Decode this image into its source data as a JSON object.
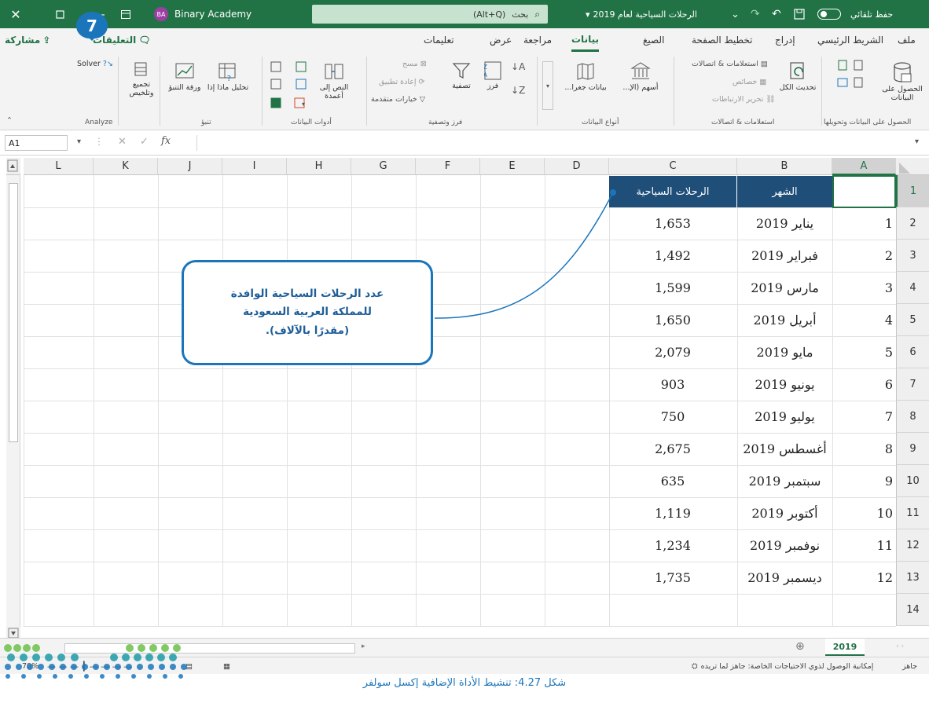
{
  "titlebar": {
    "autosave_label": "حفظ تلقائي",
    "file_name": "الرحلات السياحية لعام 2019",
    "search_placeholder": "بحث",
    "search_shortcut": "(Alt+Q)",
    "user_initials": "BA",
    "user_name": "Binary Academy"
  },
  "ribbon_tabs": [
    "ملف",
    "الشريط الرئيسي",
    "إدراج",
    "تخطيط الصفحة",
    "الصيغ",
    "بيانات",
    "مراجعة",
    "عرض",
    "تعليمات"
  ],
  "active_tab": "بيانات",
  "share_label": "مشاركة",
  "comments_label": "التعليقات",
  "ribbon_groups": {
    "get_transform": {
      "label": "الحصول على البيانات وتحويلها",
      "get_data": "الحصول على البيانات",
      "small_icons": [
        "text-csv-icon",
        "web-icon",
        "table-range-icon",
        "recent-sources-icon"
      ]
    },
    "queries": {
      "label": "استعلامات & اتصالات",
      "refresh_all": "تحديث الكل",
      "queries_connections": "استعلامات & اتصالات",
      "properties": "خصائص",
      "edit_links": "تحرير الارتباطات"
    },
    "data_types": {
      "label": "أنواع البيانات",
      "stocks": "أسهم (الإ...",
      "geography": "بيانات جغرا..."
    },
    "sort_filter": {
      "label": "فرز وتصفية",
      "sort": "فرز",
      "filter": "تصفية",
      "clear": "مسح",
      "reapply": "إعادة تطبيق",
      "advanced": "خيارات متقدمة"
    },
    "data_tools": {
      "label": "أدوات البيانات",
      "text_to_columns": "النص إلى أعمدة"
    },
    "forecast": {
      "label": "تنبؤ",
      "what_if": "تحليل ماذا إذا",
      "forecast_sheet": "ورقة التنبؤ"
    },
    "outline": {
      "label": "",
      "group": "تجميع وتلخيص"
    },
    "analyze": {
      "label": "Analyze",
      "solver": "Solver"
    }
  },
  "badge_number": "7",
  "formula_bar": {
    "name_box": "A1",
    "fx": "fx",
    "value": ""
  },
  "columns": [
    "A",
    "B",
    "C",
    "D",
    "E",
    "F",
    "G",
    "H",
    "I",
    "J",
    "K",
    "L"
  ],
  "row_numbers": [
    "1",
    "2",
    "3",
    "4",
    "5",
    "6",
    "7",
    "8",
    "9",
    "10",
    "11",
    "12",
    "13",
    "14"
  ],
  "table": {
    "header_month": "الشهر",
    "header_trips": "الرحلات السياحية",
    "rows": [
      {
        "index": "1",
        "month": "يناير 2019",
        "trips": "1,653"
      },
      {
        "index": "2",
        "month": "فبراير 2019",
        "trips": "1,492"
      },
      {
        "index": "3",
        "month": "مارس 2019",
        "trips": "1,599"
      },
      {
        "index": "4",
        "month": "أبريل 2019",
        "trips": "1,650"
      },
      {
        "index": "5",
        "month": "مايو 2019",
        "trips": "2,079"
      },
      {
        "index": "6",
        "month": "يونيو 2019",
        "trips": "903"
      },
      {
        "index": "7",
        "month": "يوليو 2019",
        "trips": "750"
      },
      {
        "index": "8",
        "month": "أغسطس 2019",
        "trips": "2,675"
      },
      {
        "index": "9",
        "month": "سبتمبر 2019",
        "trips": "635"
      },
      {
        "index": "10",
        "month": "أكتوبر 2019",
        "trips": "1,119"
      },
      {
        "index": "11",
        "month": "نوفمبر 2019",
        "trips": "1,234"
      },
      {
        "index": "12",
        "month": "ديسمبر 2019",
        "trips": "1,735"
      }
    ]
  },
  "callout": {
    "line1": "عدد الرحلات السياحية الوافدة",
    "line2": "للمملكة العربية السعودية",
    "line3": "(مقدرًا بالآلاف)."
  },
  "sheet_tab": "2019",
  "status": {
    "ready": "جاهز",
    "accessibility": "إمكانية الوصول لذوي الاحتياجات الخاصة: جاهز لما تريده",
    "zoom": "70%"
  },
  "caption": "شكل 4.27: تنشيط الأداة الإضافية إكسل سولفر",
  "colors": {
    "excel_green": "#217346",
    "header_fill": "#1f4e79",
    "callout_border": "#1b75bb",
    "badge": "#1b75bb"
  }
}
